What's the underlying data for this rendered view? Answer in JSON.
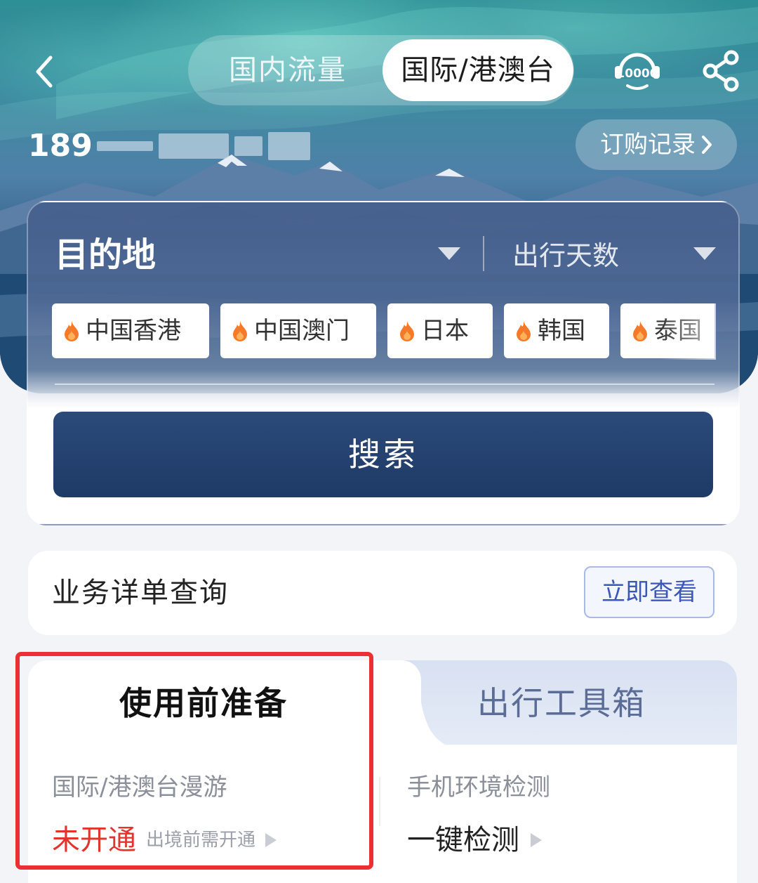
{
  "topbar": {
    "tabs": [
      {
        "label": "国内流量",
        "selected": false
      },
      {
        "label": "国际/港澳台",
        "selected": true
      }
    ],
    "service_icon": "hotline-10000-icon",
    "service_icon_text": "10000",
    "share_icon": "share-icon",
    "back_icon": "chevron-left-icon"
  },
  "account": {
    "phone_prefix": "189",
    "orders_label": "订购记录"
  },
  "search": {
    "destination_label": "目的地",
    "days_label": "出行天数",
    "hot_destinations": [
      {
        "label": "中国香港",
        "icon": "fire-icon"
      },
      {
        "label": "中国澳门",
        "icon": "fire-icon"
      },
      {
        "label": "日本",
        "icon": "fire-icon"
      },
      {
        "label": "韩国",
        "icon": "fire-icon"
      },
      {
        "label": "泰国",
        "icon": "fire-icon"
      }
    ],
    "search_button": "搜索"
  },
  "detail_query": {
    "label": "业务详单查询",
    "button": "立即查看"
  },
  "bottom_tabs": {
    "tabs": [
      {
        "label": "使用前准备",
        "selected": true
      },
      {
        "label": "出行工具箱",
        "selected": false
      }
    ],
    "roaming": {
      "title": "国际/港澳台漫游",
      "status": "未开通",
      "hint": "出境前需开通"
    },
    "env_check": {
      "title": "手机环境检测",
      "action": "一键检测"
    }
  },
  "colors": {
    "accent_blue": "#1e3a66",
    "status_red": "#e2342e",
    "highlight_red": "#ec2f35",
    "link_blue": "#3b58b8"
  }
}
